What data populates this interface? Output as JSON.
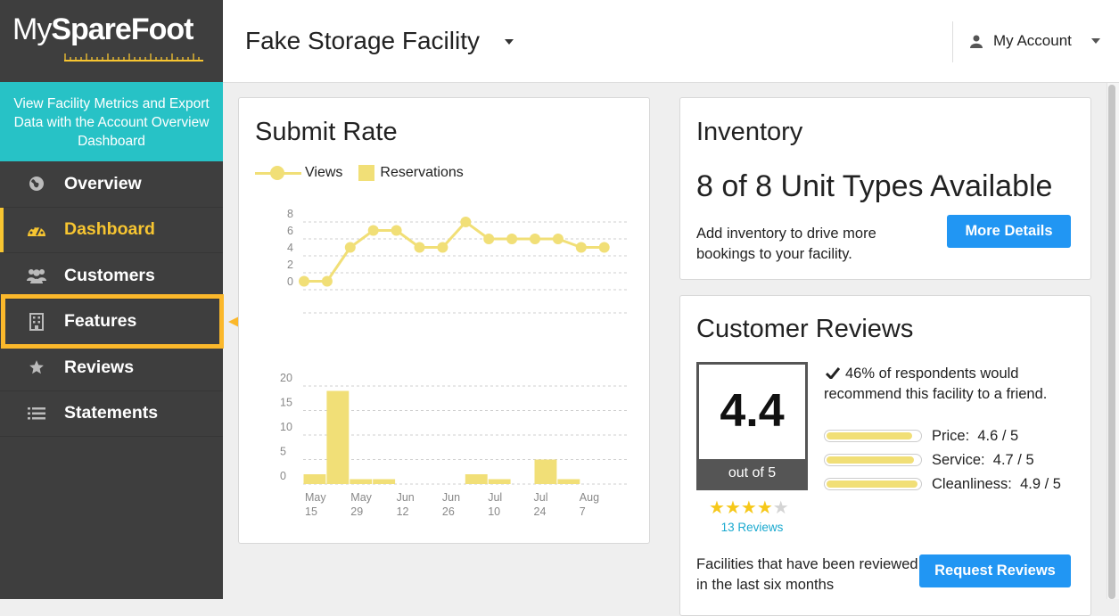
{
  "brand": {
    "name_light": "My",
    "name_bold": "SpareFoot"
  },
  "promo": {
    "text": "View Facility Metrics and Export Data with the Account Overview Dashboard"
  },
  "nav": {
    "items": [
      {
        "label": "Overview",
        "icon": "globe-icon"
      },
      {
        "label": "Dashboard",
        "icon": "dashboard-icon",
        "active": true
      },
      {
        "label": "Customers",
        "icon": "users-icon"
      },
      {
        "label": "Features",
        "icon": "building-icon",
        "highlighted": true
      },
      {
        "label": "Reviews",
        "icon": "star-icon"
      },
      {
        "label": "Statements",
        "icon": "list-icon"
      }
    ]
  },
  "header": {
    "facility_name": "Fake Storage Facility",
    "account_label": "My Account"
  },
  "colors": {
    "accent_teal": "#27c2c6",
    "active_yellow": "#f7c531",
    "highlight_orange": "#fbb82b",
    "chart_yellow": "#f1df77",
    "button_blue": "#2196f3"
  },
  "submit_rate": {
    "title": "Submit Rate",
    "legend": {
      "views": "Views",
      "reservations": "Reservations"
    }
  },
  "chart_data": [
    {
      "type": "line",
      "series": [
        {
          "name": "Views",
          "values": [
            1,
            1,
            5,
            7,
            7,
            5,
            5,
            8,
            6,
            6,
            6,
            6,
            5,
            5
          ]
        }
      ],
      "y_ticks": [
        "8",
        "6",
        "4",
        "2",
        "0"
      ],
      "ylim": [
        0,
        8
      ],
      "grid": true
    },
    {
      "type": "bar",
      "series": [
        {
          "name": "Reservations",
          "values": [
            2,
            19,
            1,
            1,
            0,
            0,
            0,
            2,
            1,
            0,
            5,
            1,
            0,
            0
          ]
        }
      ],
      "y_ticks": [
        "20",
        "15",
        "10",
        "5",
        "0"
      ],
      "ylim": [
        0,
        20
      ],
      "x_ticks": [
        {
          "top": "May",
          "bottom": "15"
        },
        {
          "top": "May",
          "bottom": "29"
        },
        {
          "top": "Jun",
          "bottom": "12"
        },
        {
          "top": "Jun",
          "bottom": "26"
        },
        {
          "top": "Jul",
          "bottom": "10"
        },
        {
          "top": "Jul",
          "bottom": "24"
        },
        {
          "top": "Aug",
          "bottom": "7"
        }
      ],
      "grid": true
    }
  ],
  "inventory": {
    "title": "Inventory",
    "headline": "8 of 8 Unit Types Available",
    "description": "Add inventory to drive more bookings to your facility.",
    "button": "More Details"
  },
  "reviews": {
    "title": "Customer Reviews",
    "score": "4.4",
    "score_sub": "out of 5",
    "stars_filled": 4,
    "stars_total": 5,
    "count": "13 Reviews",
    "recommend": "46% of respondents would recommend this facility to a friend.",
    "ratings": [
      {
        "label": "Price:",
        "value": "4.6 / 5",
        "fraction": 0.92
      },
      {
        "label": "Service:",
        "value": "4.7 / 5",
        "fraction": 0.94
      },
      {
        "label": "Cleanliness:",
        "value": "4.9 / 5",
        "fraction": 0.98
      }
    ],
    "footer": "Facilities that have been reviewed in the last six months",
    "button": "Request Reviews"
  }
}
